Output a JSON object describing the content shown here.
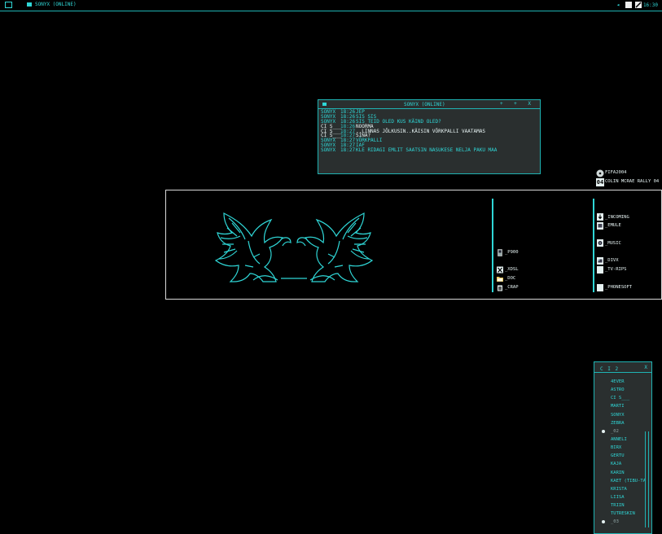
{
  "taskbar": {
    "task_label": "Sonyx (Online)",
    "clock": "16:30"
  },
  "chat": {
    "title": "Sonyx (Online)",
    "controls": "+ + x",
    "messages": [
      {
        "name": "SONYX",
        "time": "18:26",
        "text": "JEP",
        "self": true
      },
      {
        "name": "SONYX",
        "time": "18:26",
        "text": "SIS SIS",
        "self": true
      },
      {
        "name": "SONYX",
        "time": "18:26",
        "text": "SIS TEID OLED KUS KÄIND OLED?",
        "self": true
      },
      {
        "name": "CI S___",
        "time": "18:26",
        "text": "NOORMA",
        "self": false
      },
      {
        "name": "CI S___",
        "time": "18:27",
        "text": "..LINNAS JÕLKUSIN..KÄISIN VÕRKPALLI VAATAMAS",
        "self": false
      },
      {
        "name": "CI S___",
        "time": "18:27",
        "text": "SINA?",
        "self": false
      },
      {
        "name": "SONYX",
        "time": "18:27",
        "text": "VÕRKPALLI",
        "self": true
      },
      {
        "name": "SONYX",
        "time": "18:27",
        "text": "IAF",
        "self": true
      },
      {
        "name": "SONYX",
        "time": "18:27",
        "text": "KLE RIDAGI EMLIT SAATSIN NASUKESE NELJA PAKU MAA",
        "self": true
      }
    ]
  },
  "desktop": {
    "shortcuts": [
      {
        "label": "FIFA2004",
        "icon": "disc-icon"
      },
      {
        "label": "COLIN MCRAE RALLY 04",
        "icon": "rally-04-icon",
        "badge": "04"
      }
    ]
  },
  "panel": {
    "middle_items": [
      {
        "label": "_P900",
        "icon": "phone-icon"
      },
      {
        "label": "_XDSL",
        "icon": "x-icon"
      },
      {
        "label": "_DOC",
        "icon": "folder-icon"
      },
      {
        "label": "_CRAP",
        "icon": "trash-icon"
      }
    ],
    "right_items": [
      {
        "label": "_INCOMING",
        "icon": "download-icon"
      },
      {
        "label": "_EMULE",
        "icon": "emule-icon"
      },
      {
        "label": "_MUSIC",
        "icon": "music-icon"
      },
      {
        "label": "_DIVX",
        "icon": "film-icon"
      },
      {
        "label": "_TV-RIPS",
        "icon": "tv-icon"
      },
      {
        "label": "_PHONESOFT",
        "icon": "phone-soft-icon"
      }
    ]
  },
  "contacts": {
    "title": "C I  2",
    "close": "x",
    "items": [
      {
        "label": "4EVER",
        "group": false
      },
      {
        "label": "ASTRO",
        "group": false
      },
      {
        "label": "CI S___",
        "group": false
      },
      {
        "label": "MARTI",
        "group": false
      },
      {
        "label": "SONYX",
        "group": false
      },
      {
        "label": "ZEBRA",
        "group": false
      },
      {
        "label": "_02",
        "group": true
      },
      {
        "label": "ANNELI",
        "group": false
      },
      {
        "label": "BIRX",
        "group": false
      },
      {
        "label": "GERTU",
        "group": false
      },
      {
        "label": "KAJA",
        "group": false
      },
      {
        "label": "KARIN",
        "group": false
      },
      {
        "label": "KAET (TIBU-TA",
        "group": false
      },
      {
        "label": "KRISTA",
        "group": false
      },
      {
        "label": "LIISA",
        "group": false
      },
      {
        "label": "TRIIN",
        "group": false
      },
      {
        "label": "TUTRESKIN",
        "group": false
      },
      {
        "label": "_03",
        "group": true
      }
    ]
  },
  "colors": {
    "accent": "#2fd6d6",
    "background": "#000000",
    "window": "#2a2f2f"
  }
}
